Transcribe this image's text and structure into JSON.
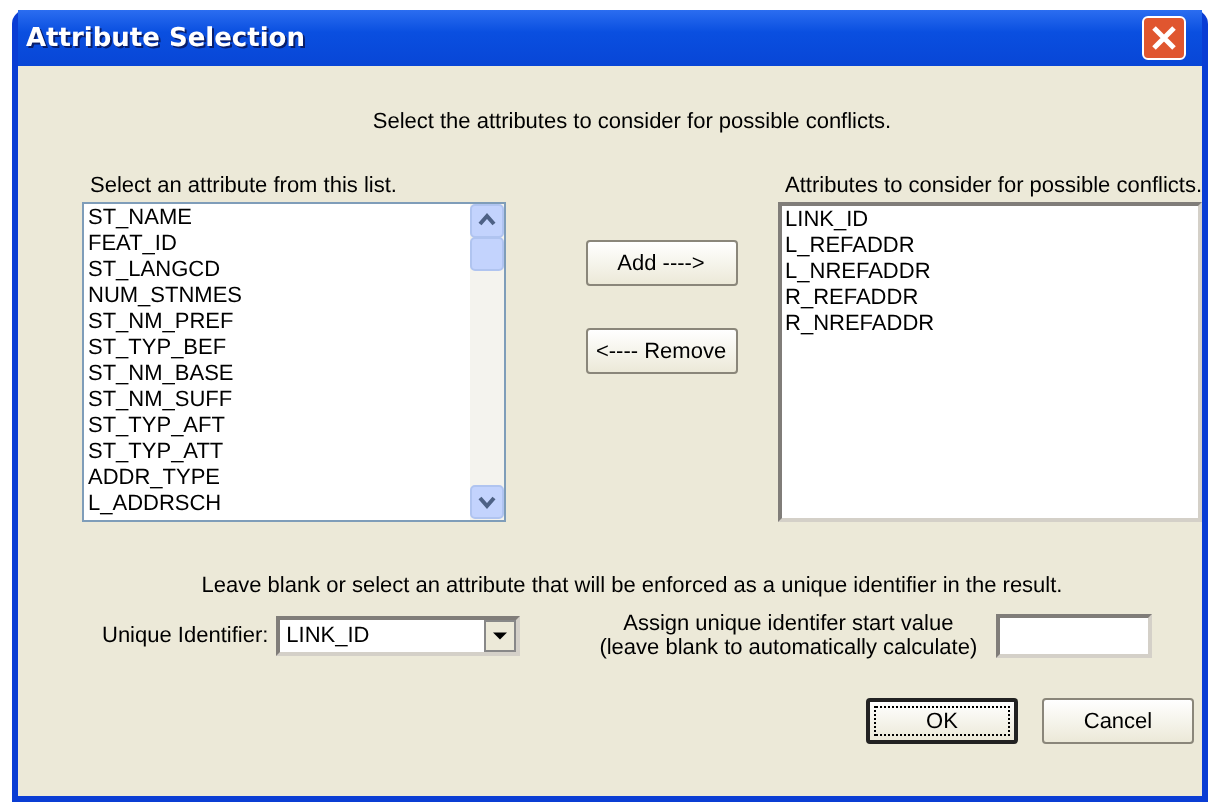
{
  "window": {
    "title": "Attribute Selection"
  },
  "instruction": "Select the attributes to consider for possible conflicts.",
  "available": {
    "label": "Select an attribute from this list.",
    "items": [
      "ST_NAME",
      "FEAT_ID",
      "ST_LANGCD",
      "NUM_STNMES",
      "ST_NM_PREF",
      "ST_TYP_BEF",
      "ST_NM_BASE",
      "ST_NM_SUFF",
      "ST_TYP_AFT",
      "ST_TYP_ATT",
      "ADDR_TYPE",
      "L_ADDRSCH"
    ]
  },
  "move_buttons": [
    {
      "label": "Add ---->"
    },
    {
      "label": "<---- Remove"
    }
  ],
  "chosen": {
    "label": "Attributes to consider for possible conflicts.",
    "items": [
      "LINK_ID",
      "L_REFADDR",
      "L_NREFADDR",
      "R_REFADDR",
      "R_NREFADDR"
    ]
  },
  "unique_note": "Leave blank or select an attribute that will be enforced as a unique identifier in the result.",
  "unique_identifier": {
    "label": "Unique Identifier:",
    "value": "LINK_ID"
  },
  "start_value": {
    "label_lines": [
      "Assign unique identifer start value",
      "(leave blank to automatically calculate)"
    ]
  },
  "buttons": [
    {
      "label": "OK",
      "default": true
    },
    {
      "label": "Cancel",
      "default": false
    }
  ]
}
